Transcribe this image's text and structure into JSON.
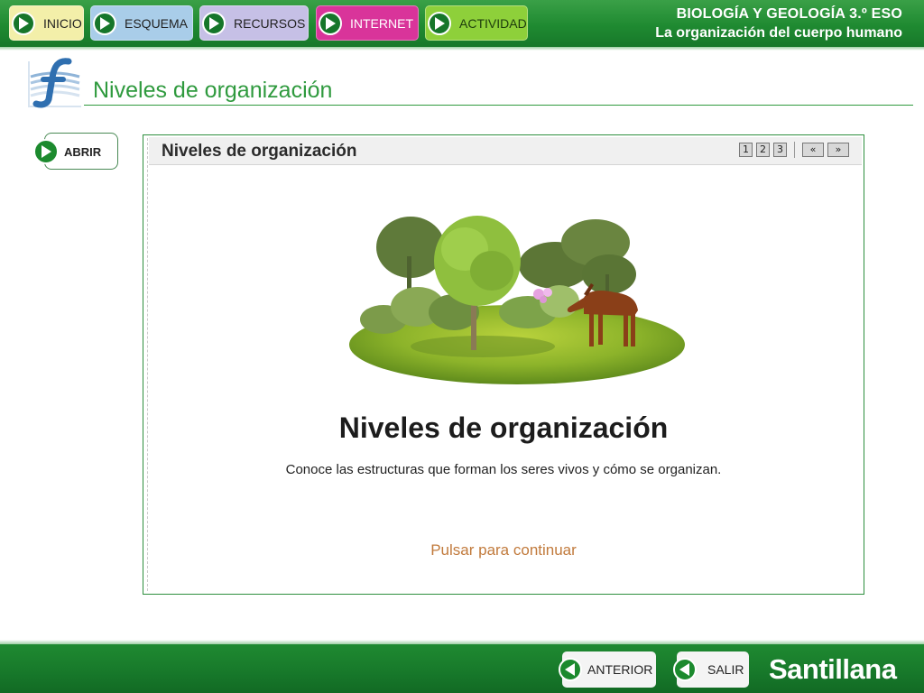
{
  "nav": {
    "inicio": "INICIO",
    "esquema": "ESQUEMA",
    "recursos": "RECURSOS",
    "internet": "INTERNET",
    "actividad": "ACTIVIDAD"
  },
  "course": {
    "line1": "BIOLOGÍA Y GEOLOGÍA 3.º ESO",
    "line2": "La organización del cuerpo humano"
  },
  "section": {
    "title": "Niveles de organización",
    "icon": "flash-icon"
  },
  "abrir_label": "ABRIR",
  "frame": {
    "header_title": "Niveles de organización",
    "pages": [
      "1",
      "2",
      "3"
    ],
    "prev": "«",
    "next": "»",
    "main_title": "Niveles de organización",
    "subtitle": "Conoce las estructuras que forman los seres vivos y cómo se organizan.",
    "continue": "Pulsar para continuar"
  },
  "footer": {
    "anterior": "ANTERIOR",
    "salir": "SALIR",
    "brand": "Santillana"
  },
  "colors": {
    "header_green": "#1f8a31",
    "title_green": "#2f9a3e",
    "continue_orange": "#c17a3c",
    "inicio": "#f3efa9",
    "esquema": "#a9cde9",
    "recursos": "#c6c0e6",
    "internet": "#d9349a",
    "actividad": "#8ed03a"
  }
}
